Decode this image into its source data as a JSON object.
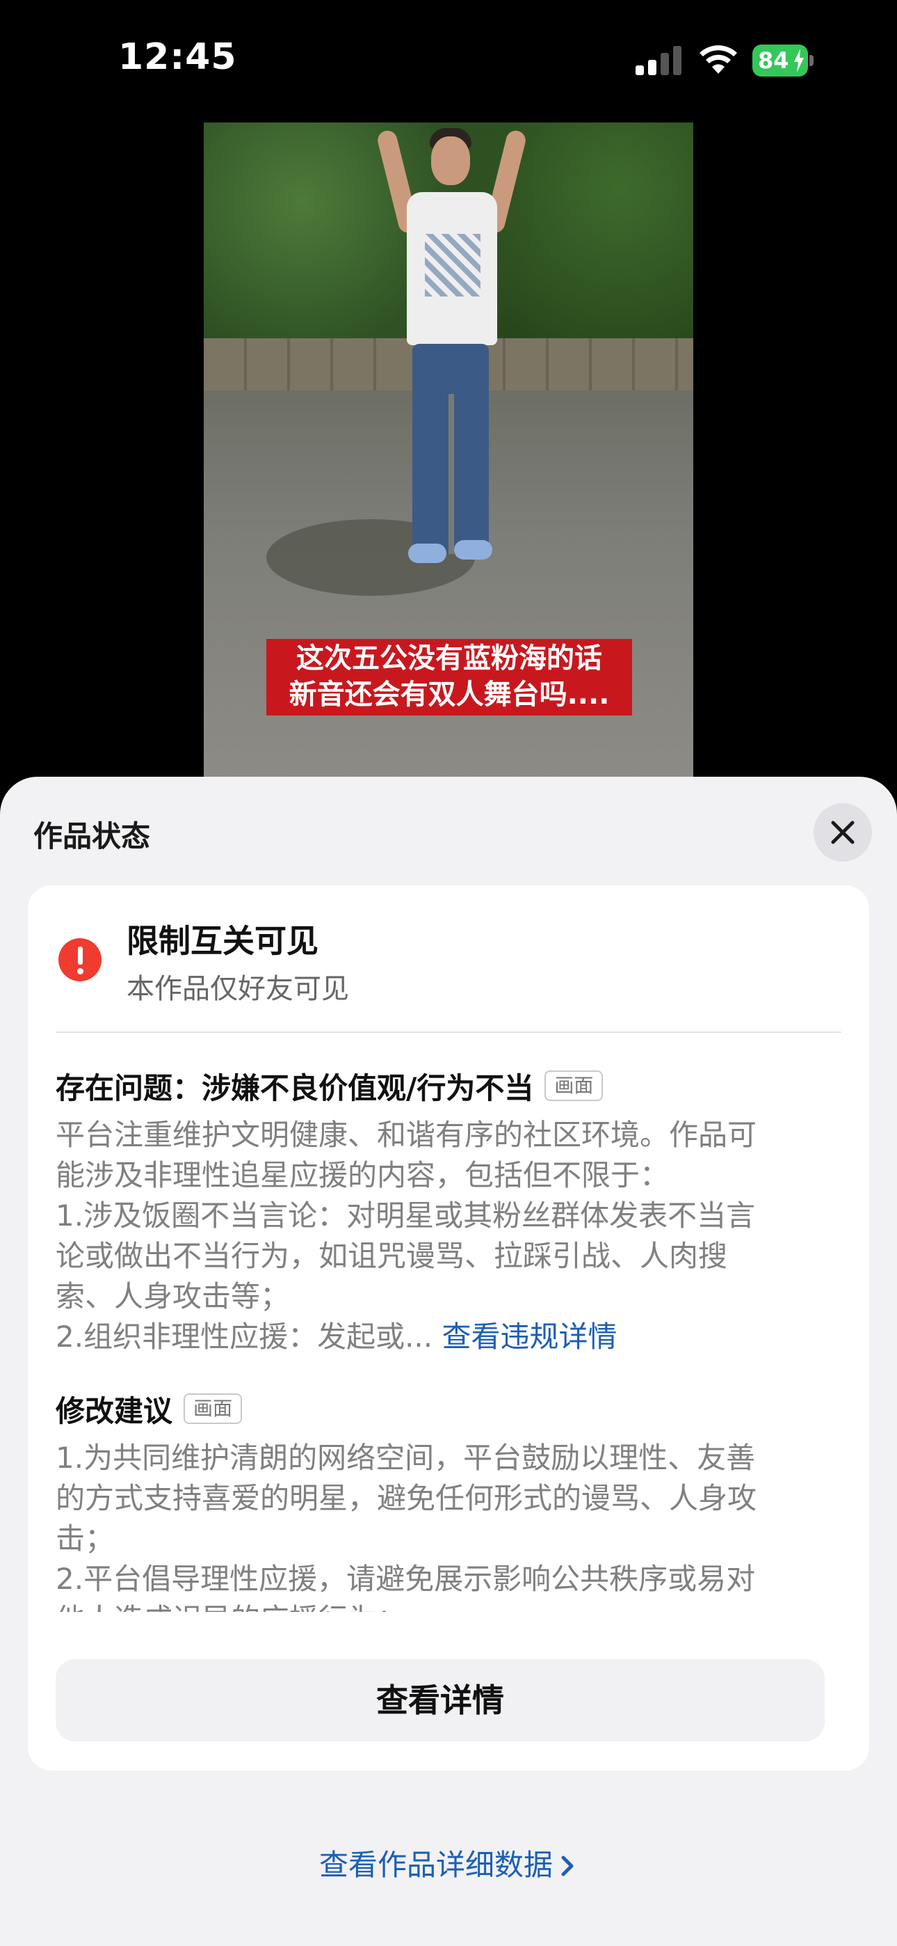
{
  "status_bar": {
    "time": "12:45",
    "battery": "84",
    "battery_color": "#34c759"
  },
  "video": {
    "caption_line1": "这次五公没有蓝粉海的话",
    "caption_line2": "新音还会有双人舞台吗...."
  },
  "sheet": {
    "title": "作品状态",
    "close_icon": "close-icon",
    "status": {
      "icon": "warning-icon",
      "icon_color": "#f03b2f",
      "title": "限制互关可见",
      "subtitle": "本作品仅好友可见"
    },
    "issue": {
      "label": "存在问题：涉嫌不良价值观/行为不当",
      "tag": "画面",
      "lines": [
        "平台注重维护文明健康、和谐有序的社区环境。作品可",
        "能涉及非理性追星应援的内容，包括但不限于：",
        "1.涉及饭圈不当言论：对明星或其粉丝群体发表不当言",
        "论或做出不当行为，如诅咒谩骂、拉踩引战、人肉搜",
        "索、人身攻击等；",
        "2.组织非理性应援：发起或..."
      ],
      "more_link": "查看违规详情",
      "link_color": "#1c5fb5"
    },
    "suggestion": {
      "label": "修改建议",
      "tag": "画面",
      "lines": [
        "1.为共同维护清朗的网络空间，平台鼓励以理性、友善",
        "的方式支持喜爱的明星，避免任何形式的谩骂、人身攻",
        "击；",
        "2.平台倡导理性应援，请避免展示影响公共秩序或易对",
        "他人造成误导的应援行为；"
      ]
    },
    "detail_button": "查看详情",
    "data_link": "查看作品详细数据"
  }
}
